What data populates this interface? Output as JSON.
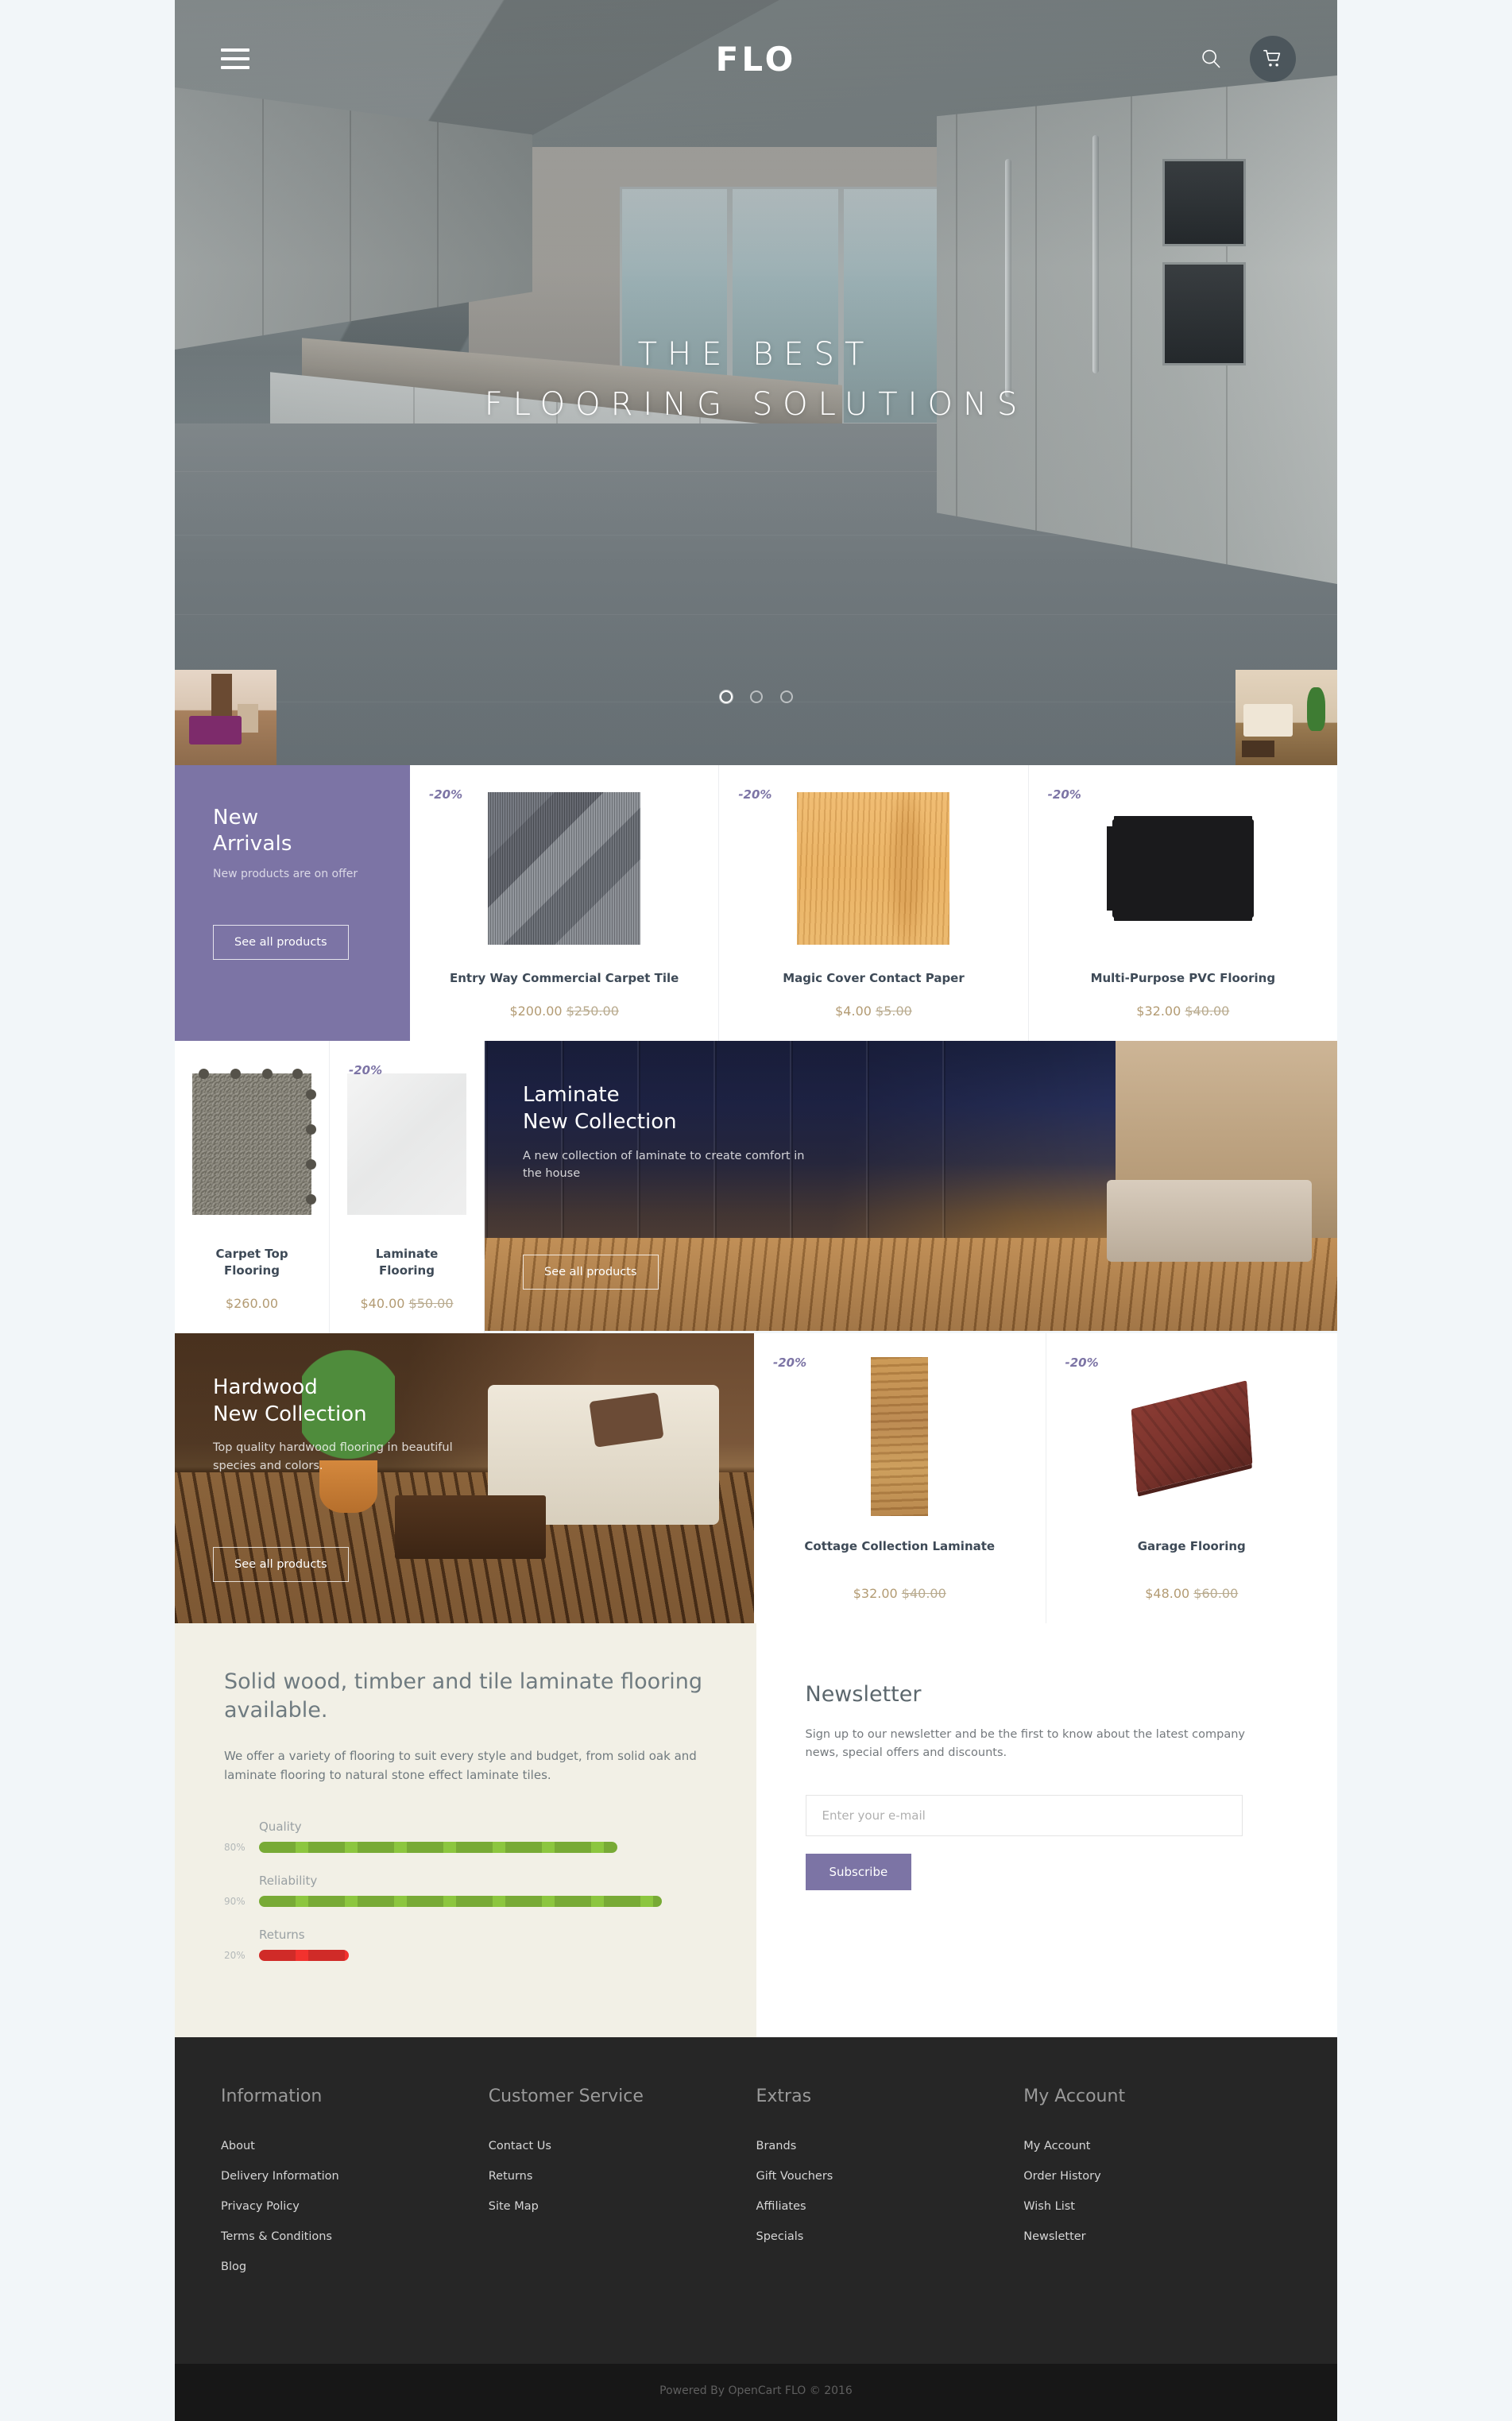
{
  "header": {
    "brand": "FLO",
    "menu_icon": "hamburger-icon",
    "search_icon": "search-icon",
    "cart_icon": "cart-icon"
  },
  "hero": {
    "title_line1": "THE BEST",
    "title_line2": "FLOORING SOLUTIONS",
    "slides": [
      "1",
      "2",
      "3"
    ],
    "active_slide": 1,
    "thumb_left": "bedroom-thumbnail",
    "thumb_right": "living-room-thumbnail"
  },
  "promo": {
    "title_line1": "New",
    "title_line2": "Arrivals",
    "subtitle": "New products are on offer",
    "button": "See all products",
    "accent": "#7c74a5"
  },
  "products_row1": [
    {
      "badge": "-20%",
      "name": "Entry Way Commercial Carpet Tile",
      "price": "$200.00",
      "old_price": "$250.00",
      "image": "commercial-carpet-tile-image"
    },
    {
      "badge": "-20%",
      "name": "Magic Cover Contact Paper",
      "price": "$4.00",
      "old_price": "$5.00",
      "image": "contact-paper-image"
    },
    {
      "badge": "-20%",
      "name": "Multi-Purpose PVC Flooring",
      "price": "$32.00",
      "old_price": "$40.00",
      "image": "pvc-flooring-image"
    }
  ],
  "products_row2": [
    {
      "badge": "",
      "name": "Carpet Top Flooring",
      "price": "$260.00",
      "old_price": "",
      "image": "carpet-top-flooring-image"
    },
    {
      "badge": "-20%",
      "name": "Laminate Flooring",
      "price": "$40.00",
      "old_price": "$50.00",
      "image": "laminate-flooring-image"
    }
  ],
  "products_row3": [
    {
      "badge": "-20%",
      "name": "Cottage Collection Laminate",
      "price": "$32.00",
      "old_price": "$40.00",
      "image": "cottage-laminate-image"
    },
    {
      "badge": "-20%",
      "name": "Garage Flooring",
      "price": "$48.00",
      "old_price": "$60.00",
      "image": "garage-flooring-image"
    }
  ],
  "collection_laminate": {
    "title_line1": "Laminate",
    "title_line2": "New Collection",
    "description": "A new collection of laminate to create comfort in the house",
    "button": "See all products"
  },
  "collection_hardwood": {
    "title_line1": "Hardwood",
    "title_line2": "New Collection",
    "description": "Top quality hardwood flooring in beautiful species and colors.",
    "button": "See all products"
  },
  "info": {
    "title": "Solid wood, timber and tile laminate flooring available.",
    "lead": "We offer a variety of flooring to suit every style and budget, from solid oak and laminate flooring to natural stone effect laminate tiles.",
    "bars": [
      {
        "label": "Quality",
        "pct_label": "80%",
        "value": 80,
        "color": "#8cc63f"
      },
      {
        "label": "Reliability",
        "pct_label": "90%",
        "value": 90,
        "color": "#8cc63f"
      },
      {
        "label": "Returns",
        "pct_label": "20%",
        "value": 20,
        "color": "#f2322e"
      }
    ]
  },
  "newsletter": {
    "title": "Newsletter",
    "description": "Sign up to our newsletter and be the first to know about the latest company news, special offers and discounts.",
    "placeholder": "Enter your e-mail",
    "value": "",
    "button": "Subscribe"
  },
  "footer": {
    "columns": [
      {
        "heading": "Information",
        "links": [
          "About",
          "Delivery Information",
          "Privacy Policy",
          "Terms & Conditions",
          "Blog"
        ]
      },
      {
        "heading": "Customer Service",
        "links": [
          "Contact Us",
          "Returns",
          "Site Map"
        ]
      },
      {
        "heading": "Extras",
        "links": [
          "Brands",
          "Gift Vouchers",
          "Affiliates",
          "Specials"
        ]
      },
      {
        "heading": "My Account",
        "links": [
          "My Account",
          "Order History",
          "Wish List",
          "Newsletter"
        ]
      }
    ],
    "copyright": "Powered By OpenCart FLO © 2016"
  }
}
